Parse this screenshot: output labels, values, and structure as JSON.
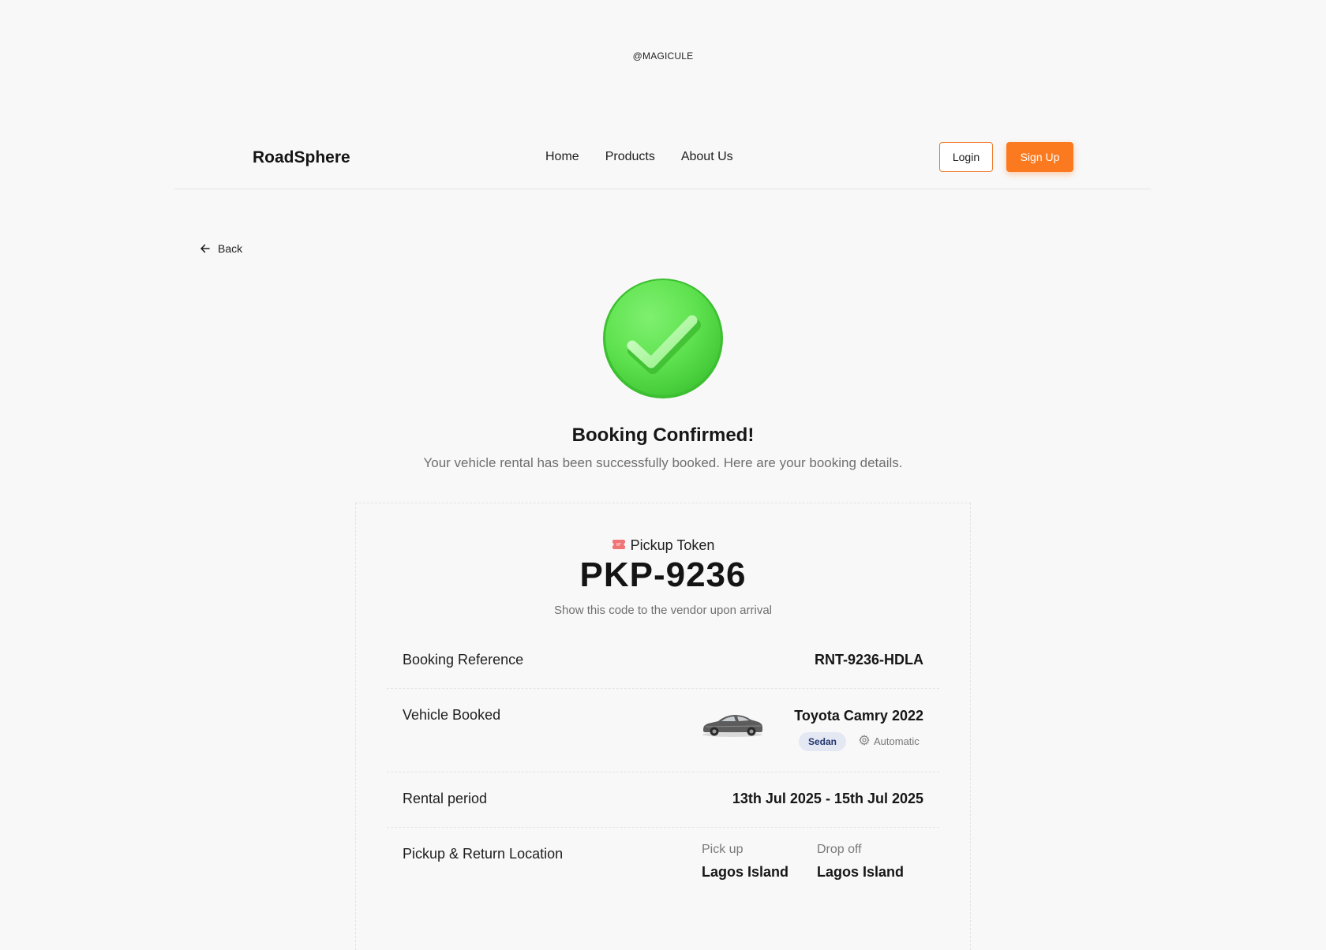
{
  "watermark": "@MAGICULE",
  "nav": {
    "brand": "RoadSphere",
    "links": [
      "Home",
      "Products",
      "About Us"
    ],
    "login_label": "Login",
    "signup_label": "Sign Up"
  },
  "back_label": "Back",
  "confirmation": {
    "title": "Booking Confirmed!",
    "subtitle": "Your vehicle rental has been successfully booked. Here are your booking details."
  },
  "token": {
    "label": "Pickup Token",
    "value": "PKP-9236",
    "hint": "Show this code to the vendor upon arrival"
  },
  "details": {
    "booking_reference": {
      "label": "Booking Reference",
      "value": "RNT-9236-HDLA"
    },
    "vehicle": {
      "label": "Vehicle Booked",
      "name": "Toyota Camry 2022",
      "category": "Sedan",
      "transmission": "Automatic"
    },
    "rental_period": {
      "label": "Rental period",
      "value": "13th Jul 2025 - 15th Jul 2025"
    },
    "location": {
      "label": "Pickup & Return Location",
      "pickup_label": "Pick up",
      "pickup_value": "Lagos Island",
      "dropoff_label": "Drop off",
      "dropoff_value": "Lagos Island"
    }
  },
  "colors": {
    "accent": "#fb7a1f",
    "success": "#5ee04f",
    "badge_bg": "#e4e8f3",
    "badge_text": "#24356f"
  },
  "icons": [
    "arrow-left-icon",
    "check-circle-icon",
    "ticket-icon",
    "car-image",
    "gear-icon"
  ]
}
